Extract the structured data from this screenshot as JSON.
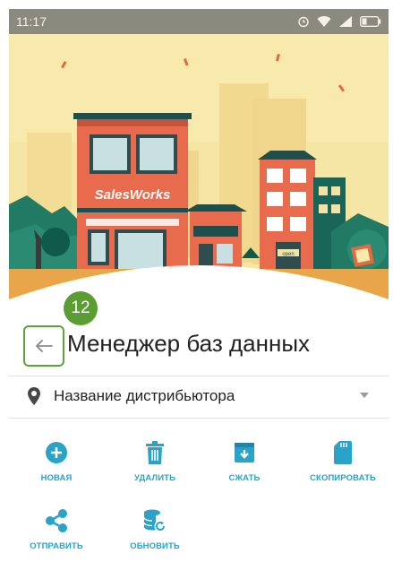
{
  "status_bar": {
    "time": "11:17",
    "icons": [
      "alarm-icon",
      "wifi-icon",
      "signal-icon",
      "battery-icon"
    ]
  },
  "banner": {
    "brand": "SalesWorks",
    "sign": "open"
  },
  "step_badge": "12",
  "header": {
    "title": "Менеджер баз данных"
  },
  "distributor": {
    "label": "Название дистрибьютора"
  },
  "actions": [
    {
      "label": "НОВАЯ",
      "icon": "plus-circle-icon"
    },
    {
      "label": "УДАЛИТЬ",
      "icon": "trash-icon"
    },
    {
      "label": "СЖАТЬ",
      "icon": "archive-down-icon"
    },
    {
      "label": "СКОПИРОВАТЬ",
      "icon": "sd-card-icon"
    },
    {
      "label": "ОТПРАВИТЬ",
      "icon": "share-icon"
    },
    {
      "label": "ОБНОВИТЬ",
      "icon": "database-refresh-icon"
    }
  ],
  "colors": {
    "accent": "#2aa3c9",
    "highlight": "#5fa23a",
    "status_bar": "#8a8a7e"
  }
}
